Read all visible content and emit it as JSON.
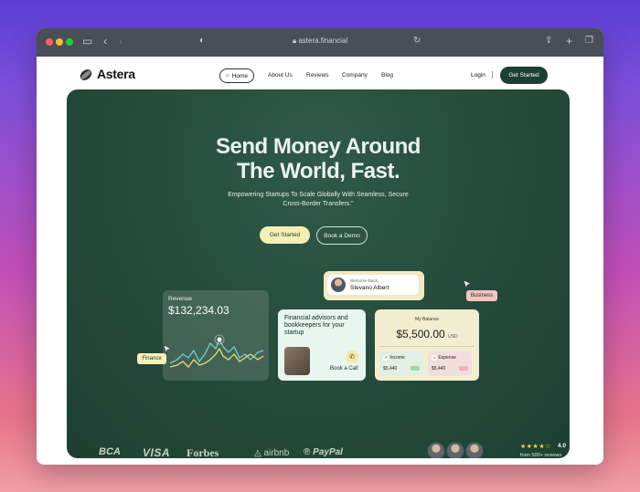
{
  "browser": {
    "url": "astera.financial"
  },
  "site": {
    "brand": "Astera",
    "nav": {
      "home": "Home",
      "about": "About Us",
      "reviews": "Reviews",
      "company": "Company",
      "blog": "Blog"
    },
    "login": "Login",
    "get_started": "Get Started"
  },
  "hero": {
    "title_line1": "Send Money Around",
    "title_line2": "The World, Fast.",
    "subtitle_line1": "Empowering Startups To Scale Globally With Seamless, Secure",
    "subtitle_line2": "Cross-Border Transfers.\"",
    "cta_primary": "Get Started",
    "cta_secondary": "Book a Demo"
  },
  "revenue_card": {
    "title": "Revenue",
    "amount": "$132,234.03"
  },
  "tags": {
    "finance": "Finance",
    "business": "Business"
  },
  "advisor_card": {
    "text": "Financial advisors and bookkeepers for your startup",
    "call": "Book a Call"
  },
  "welcome_card": {
    "label": "Welcome Back,",
    "name": "Stevano Albert"
  },
  "balance_card": {
    "label": "My Balance",
    "amount": "$5,500.00",
    "currency": "USD",
    "income_label": "Income",
    "income_value": "$5,440",
    "expense_label": "Expense",
    "expense_value": "$5,440"
  },
  "partners": [
    "BCA",
    "VISA",
    "Forbes",
    "airbnb",
    "PayPal"
  ],
  "social_proof": {
    "rating": "4.0",
    "reviews": "from 500+ reviews"
  },
  "colors": {
    "hero_green": "#244a3b",
    "accent_yellow": "#f5efb3",
    "accent_pink": "#f4c4c0",
    "dark_button": "#1e3f33"
  }
}
